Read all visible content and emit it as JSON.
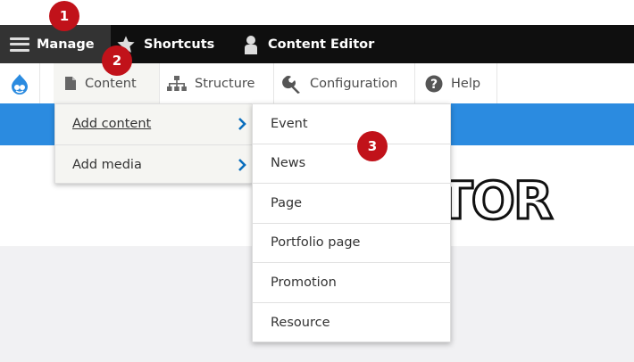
{
  "toolbar": {
    "manage_label": "Manage",
    "shortcuts_label": "Shortcuts",
    "user_label": "Content Editor"
  },
  "tray": {
    "content_label": "Content",
    "structure_label": "Structure",
    "configuration_label": "Configuration",
    "help_label": "Help"
  },
  "content_menu": {
    "items": [
      {
        "label": "Add content"
      },
      {
        "label": "Add media"
      }
    ]
  },
  "add_content_submenu": {
    "items": [
      {
        "label": "Event"
      },
      {
        "label": "News"
      },
      {
        "label": "Page"
      },
      {
        "label": "Portfolio page"
      },
      {
        "label": "Promotion"
      },
      {
        "label": "Resource"
      }
    ]
  },
  "site_logo_text": "TOR",
  "callouts": [
    "1",
    "2",
    "3"
  ],
  "colors": {
    "toolbar_bg": "#0f0f0f",
    "manage_bg": "#333333",
    "accent_blue": "#2b8be0",
    "callout_red": "#c1121a",
    "chevron_blue": "#0a6ebd"
  },
  "icons": {
    "manage": "hamburger-icon",
    "shortcuts": "star-icon",
    "user": "user-icon",
    "home": "drupal-drop-icon",
    "content": "document-icon",
    "structure": "sitemap-icon",
    "configuration": "wrench-icon",
    "help": "question-circle-icon",
    "submenu": "chevron-right-icon"
  }
}
